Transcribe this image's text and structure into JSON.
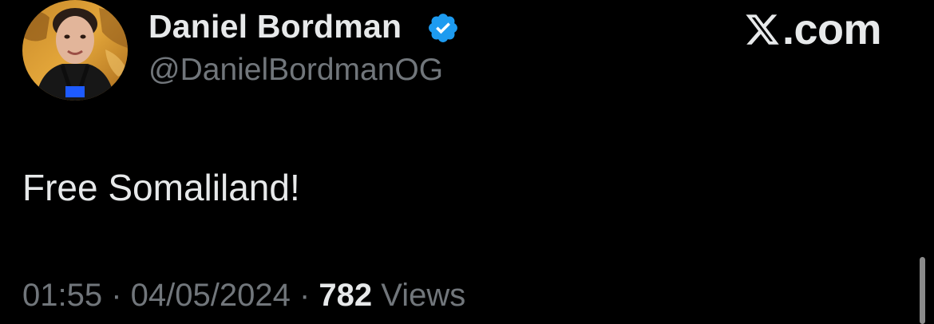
{
  "author": {
    "display_name": "Daniel Bordman",
    "handle": "@DanielBordmanOG",
    "verified_icon": "verified-badge-icon",
    "verified_color": "#1d9bf0"
  },
  "brand": {
    "x_glyph": "X",
    "domain": ".com"
  },
  "tweet": {
    "text": "Free Somaliland!",
    "time": "01:55",
    "separator": " · ",
    "date": "04/05/2024",
    "views_count": "782",
    "views_label": "Views"
  },
  "colors": {
    "background": "#000000",
    "primary_text": "#e7e9ea",
    "secondary_text": "#71767b"
  }
}
